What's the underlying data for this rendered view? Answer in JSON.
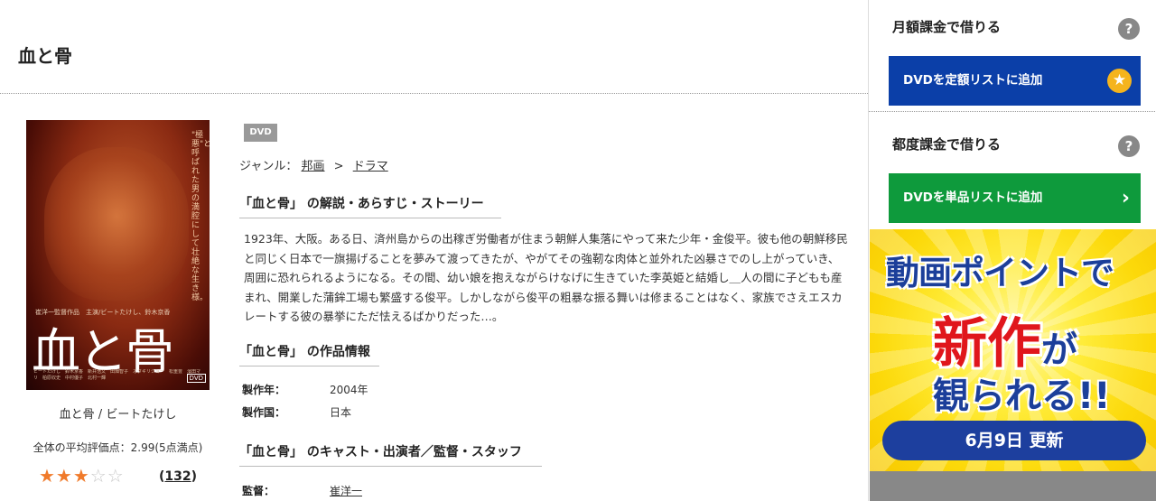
{
  "header": {
    "title": "血と骨"
  },
  "cover": {
    "tagline": "\"極悪\"と呼ばれた男の満腔にして壮絶な生き様。",
    "credit": "崔洋一監督作品　主演/ビートたけし、鈴木京香",
    "big_title": "血と骨",
    "small_text": "ビートたけし　鈴木京香　新井浩文　田畑智子　オダギリジョー　松重豊　濱田マリ　柏原収史　中村優子　北村一輝",
    "dvd_mark": "DVD"
  },
  "caption": "血と骨 / ビートたけし",
  "rating": {
    "label": "全体の平均評価点：2.99(5点満点)",
    "value": 2.99,
    "max": 5,
    "stars_on": "★★★",
    "stars_off": "☆☆",
    "count_open": "(",
    "count": "132",
    "count_close": ")"
  },
  "badge": "DVD",
  "genre": {
    "label": "ジャンル：",
    "parent": "邦画",
    "separator": ">",
    "child": "ドラマ"
  },
  "sections": {
    "synopsis_title": "「血と骨」 の解説・あらすじ・ストーリー",
    "info_title": "「血と骨」 の作品情報",
    "cast_title": "「血と骨」 のキャスト・出演者／監督・スタッフ"
  },
  "synopsis": "1923年、大阪。ある日、済州島からの出稼ぎ労働者が住まう朝鮮人集落にやって来た少年・金俊平。彼も他の朝鮮移民と同じく日本で一旗揚げることを夢みて渡ってきたが、やがてその強靭な肉体と並外れた凶暴さでのし上がっていき、周囲に恐れられるようになる。その間、幼い娘を抱えながらけなげに生きていた李英姫と結婚し＿人の間に子どもも産まれ、開業した蒲鉾工場も繁盛する俊平。しかしながら俊平の粗暴な振る舞いは修まることはなく、家族でさえエスカレートする彼の暴挙にただ怯えるばかりだった…。",
  "info": {
    "year_label": "製作年：",
    "year_value": "2004年",
    "country_label": "製作国：",
    "country_value": "日本"
  },
  "cast": {
    "director_label": "監督：",
    "director_value": "崔洋一"
  },
  "sidebar": {
    "monthly_title": "月額課金で借りる",
    "monthly_button": "DVDを定額リストに追加",
    "single_title": "都度課金で借りる",
    "single_button": "DVDを単品リストに追加",
    "help_glyph": "?",
    "star_glyph": "★",
    "chevron_glyph": "›"
  },
  "promo": {
    "line1": "動画ポイントで",
    "line2_main": "新作",
    "line2_suffix": "が",
    "line3": "観られる!!",
    "date": "6月9日 更新"
  },
  "colors": {
    "blue_button": "#0b3fa8",
    "green_button": "#0e9a3c",
    "star": "#f07a2a",
    "promo_red": "#e0161c",
    "promo_blue": "#1c3f9a"
  }
}
